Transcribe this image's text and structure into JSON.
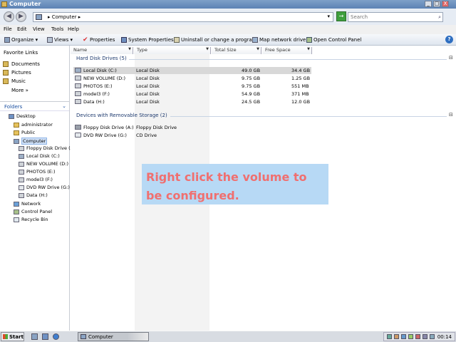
{
  "window": {
    "title": "Computer",
    "controls": {
      "minimize": "_",
      "maximize": "□",
      "close": "X"
    }
  },
  "address": {
    "crumb": "▸ Computer ▸",
    "search_placeholder": "Search"
  },
  "menu": [
    "File",
    "Edit",
    "View",
    "Tools",
    "Help"
  ],
  "toolbar": {
    "organize": "Organize ▾",
    "views": "Views ▾",
    "properties": "Properties",
    "system_properties": "System Properties",
    "uninstall": "Uninstall or change a program",
    "map_drive": "Map network drive",
    "control_panel": "Open Control Panel"
  },
  "favorites": {
    "title": "Favorite Links",
    "items": [
      "Documents",
      "Pictures",
      "Music",
      "More »"
    ]
  },
  "folders": {
    "label": "Folders",
    "tree": [
      "Desktop",
      "administrator",
      "Public",
      "Computer",
      "Floppy Disk Drive (A:)",
      "Local Disk (C:)",
      "NEW VOLUME (D:)",
      "PHOTOS (E:)",
      "model3 (F:)",
      "DVD RW Drive (G:)",
      "Data (H:)",
      "Network",
      "Control Panel",
      "Recycle Bin"
    ]
  },
  "columns": [
    "Name",
    "Type",
    "Total Size",
    "Free Space"
  ],
  "hard_disks": {
    "header": "Hard Disk Drives (5)",
    "rows": [
      {
        "name": "Local Disk (C:)",
        "type": "Local Disk",
        "total": "49.0 GB",
        "free": "34.4 GB"
      },
      {
        "name": "NEW VOLUME (D:)",
        "type": "Local Disk",
        "total": "9.75 GB",
        "free": "1.25 GB"
      },
      {
        "name": "PHOTOS (E:)",
        "type": "Local Disk",
        "total": "9.75 GB",
        "free": "551 MB"
      },
      {
        "name": "model3 (F:)",
        "type": "Local Disk",
        "total": "54.9 GB",
        "free": "371 MB"
      },
      {
        "name": "Data (H:)",
        "type": "Local Disk",
        "total": "24.5 GB",
        "free": "12.0 GB"
      }
    ]
  },
  "removable": {
    "header": "Devices with Removable Storage (2)",
    "rows": [
      {
        "name": "Floppy Disk Drive (A:)",
        "type": "Floppy Disk Drive"
      },
      {
        "name": "DVD RW Drive (G:)",
        "type": "CD Drive"
      }
    ]
  },
  "callout": {
    "text": "Right click the volume to be configured."
  },
  "taskbar": {
    "start": "Start",
    "task": "Computer",
    "clock": "00:14"
  },
  "colors": {
    "callout_bg": "#b7d9f5",
    "callout_text": "#f06f6f",
    "titlebar": "#6a8ebf"
  }
}
